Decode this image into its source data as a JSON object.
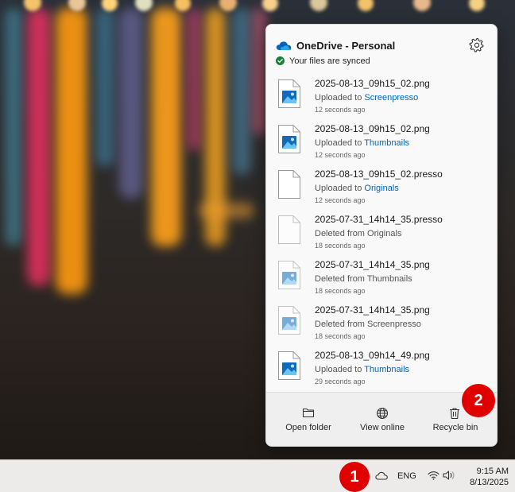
{
  "flyout": {
    "title": "OneDrive - Personal",
    "status": "Your files are synced",
    "files": [
      {
        "name": "2025-08-13_09h15_02.png",
        "action": "Uploaded to ",
        "location": "Screenpresso",
        "time": "12 seconds ago",
        "kind": "image-file-icon"
      },
      {
        "name": "2025-08-13_09h15_02.png",
        "action": "Uploaded to ",
        "location": "Thumbnails",
        "time": "12 seconds ago",
        "kind": "image-file-icon"
      },
      {
        "name": "2025-08-13_09h15_02.presso",
        "action": "Uploaded to ",
        "location": "Originals",
        "time": "12 seconds ago",
        "kind": "blank-file-icon"
      },
      {
        "name": "2025-07-31_14h14_35.presso",
        "action": "Deleted from Originals",
        "location": "",
        "time": "18 seconds ago",
        "kind": "blank-file-icon"
      },
      {
        "name": "2025-07-31_14h14_35.png",
        "action": "Deleted from Thumbnails",
        "location": "",
        "time": "18 seconds ago",
        "kind": "image-file-icon"
      },
      {
        "name": "2025-07-31_14h14_35.png",
        "action": "Deleted from Screenpresso",
        "location": "",
        "time": "18 seconds ago",
        "kind": "image-file-icon"
      },
      {
        "name": "2025-08-13_09h14_49.png",
        "action": "Uploaded to ",
        "location": "Thumbnails",
        "time": "29 seconds ago",
        "kind": "image-file-icon"
      }
    ],
    "footer": {
      "open_folder": "Open folder",
      "view_online": "View online",
      "recycle_bin": "Recycle bin"
    }
  },
  "taskbar": {
    "language": "ENG",
    "time": "9:15 AM",
    "date": "8/13/2025"
  },
  "markers": {
    "one": "1",
    "two": "2"
  },
  "colors": {
    "accent": "#0067c0",
    "onedrive_blue": "#0364b8",
    "synced_green": "#1a7f37",
    "marker_red": "#e00000"
  }
}
